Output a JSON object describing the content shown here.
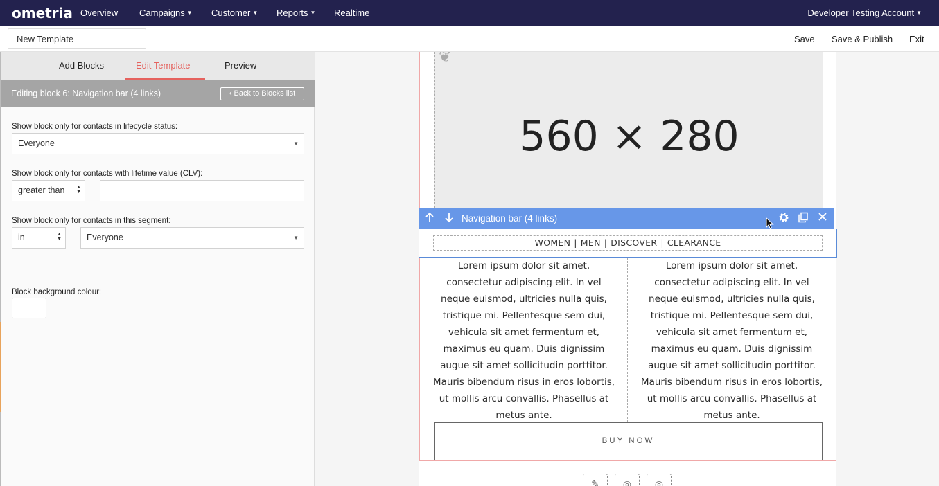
{
  "topnav": {
    "logo": "ometria",
    "items": [
      {
        "label": "Overview"
      },
      {
        "label": "Campaigns"
      },
      {
        "label": "Customer"
      },
      {
        "label": "Reports"
      },
      {
        "label": "Realtime"
      }
    ],
    "account": "Developer Testing Account"
  },
  "subbar": {
    "template_name": "New Template",
    "save": "Save",
    "save_publish": "Save & Publish",
    "exit": "Exit"
  },
  "left": {
    "tabs": [
      {
        "label": "Add Blocks"
      },
      {
        "label": "Edit Template",
        "active": true
      },
      {
        "label": "Preview"
      }
    ],
    "editing_title": "Editing block 6: Navigation bar (4 links)",
    "back_button": "‹ Back to Blocks list",
    "lifecycle_label": "Show block only for contacts in lifecycle status:",
    "lifecycle_value": "Everyone",
    "clv_label": "Show block only for contacts with lifetime value (CLV):",
    "clv_operator": "greater than",
    "clv_value": "",
    "segment_label": "Show block only for contacts in this segment:",
    "segment_operator": "in",
    "segment_value": "Everyone",
    "bg_label": "Block background colour:"
  },
  "canvas": {
    "placeholder": "560 × 280",
    "nav_block_title": "Navigation bar (4 links)",
    "nav_links": [
      "WOMEN",
      "MEN",
      "DISCOVER",
      "CLEARANCE"
    ],
    "lorem": "Lorem ipsum dolor sit amet, consectetur adipiscing elit. In vel neque euismod, ultricies nulla quis, tristique mi. Pellentesque sem dui, vehicula sit amet fermentum et, maximus eu quam. Duis dignissim augue sit amet sollicitudin porttitor. Mauris bibendum risus in eros lobortis, ut mollis arcu convallis. Phasellus at metus ante.",
    "buy_now": "BUY NOW"
  },
  "colors": {
    "nav_bg": "#23224e",
    "accent": "#e5625e",
    "block_header": "#6797e8"
  }
}
